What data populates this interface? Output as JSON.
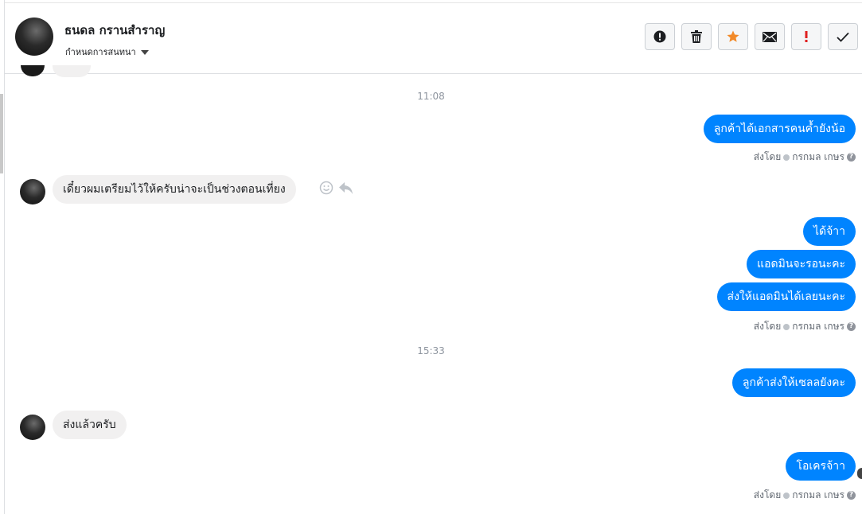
{
  "header": {
    "name": "ธนดล กรานสำราญ",
    "subtitle": "กำหนดการสนทนา",
    "tools": [
      {
        "name": "report-icon",
        "glyph": "!"
      },
      {
        "name": "trash-icon",
        "glyph": "🗑"
      },
      {
        "name": "star-icon",
        "glyph": "★"
      },
      {
        "name": "mail-icon",
        "glyph": "✉"
      },
      {
        "name": "important-icon",
        "glyph": "!"
      },
      {
        "name": "check-icon",
        "glyph": "✓"
      }
    ]
  },
  "thread": {
    "time1": "11:08",
    "time2": "15:33",
    "msg_out_1": "ลูกค้าได้เอกสารคนค้ำยังน้อ",
    "msg_in_1": "เดี๋ยวผมเตรียมไว้ให้ครับน่าจะเป็นช่วงตอนเที่ยง",
    "msg_out_2": "ได้จ้าา",
    "msg_out_3": "แอดมินจะรอนะคะ",
    "msg_out_4": "ส่งให้แอดมินได้เลยนะคะ",
    "msg_out_5": "ลูกค้าส่งให้เซลลยังคะ",
    "msg_in_2": "ส่งแล้วครับ",
    "msg_out_6": "โอเครจ้าา",
    "sent_by_label": "ส่งโดย",
    "sender_name": "กรกมล เกษร"
  },
  "colors": {
    "outgoing": "#0084ff",
    "incoming": "#f1f0f0",
    "star": "#f28a29"
  }
}
